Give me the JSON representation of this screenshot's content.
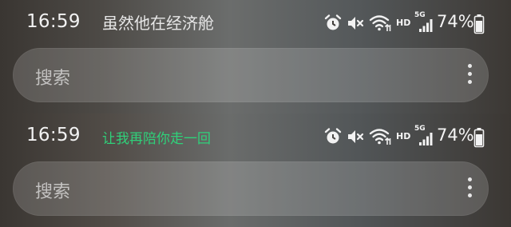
{
  "panels": [
    {
      "status": {
        "time": "16:59",
        "ticker": "虽然他在经济舱",
        "ticker_color": "#e6e6e6",
        "network_type": "HD",
        "network_gen": "5G",
        "battery": "74%",
        "icons": [
          "alarm-icon",
          "mute-icon",
          "wifi-icon",
          "signal-icon",
          "battery-icon"
        ]
      },
      "search": {
        "placeholder": "搜索"
      }
    },
    {
      "status": {
        "time": "16:59",
        "ticker": "让我再陪你走一回",
        "ticker_color": "#2fd17a",
        "network_type": "HD",
        "network_gen": "5G",
        "battery": "74%",
        "icons": [
          "alarm-icon",
          "mute-icon",
          "wifi-icon",
          "signal-icon",
          "battery-icon"
        ]
      },
      "search": {
        "placeholder": "搜索"
      }
    }
  ]
}
